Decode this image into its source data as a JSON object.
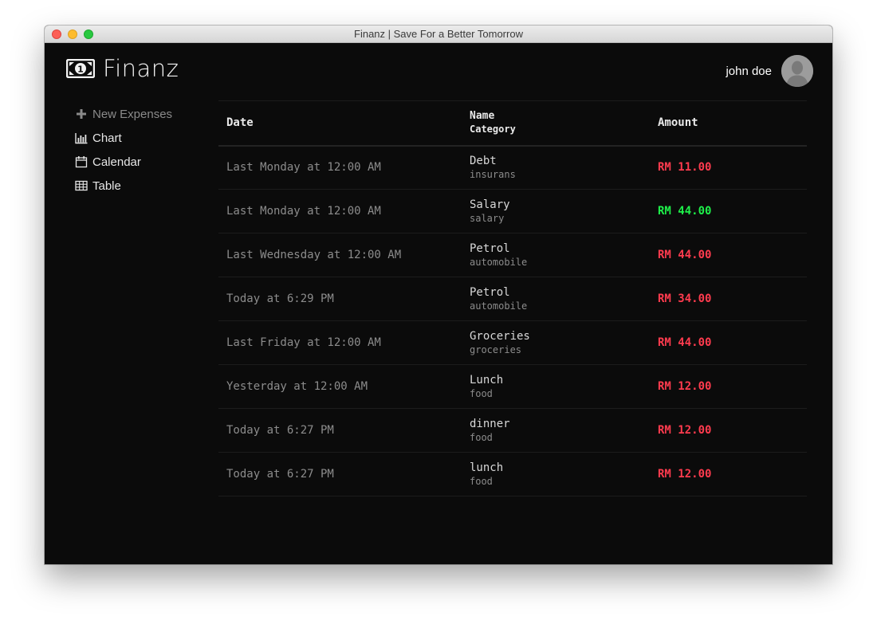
{
  "window": {
    "title": "Finanz | Save For a Better Tomorrow"
  },
  "app": {
    "brand": "Finanz",
    "brand_icon": "money-bill-icon"
  },
  "user": {
    "name": "john doe",
    "avatar_icon": "user-avatar-icon"
  },
  "sidebar": {
    "items": [
      {
        "label": "New Expenses",
        "icon": "plus-icon"
      },
      {
        "label": "Chart",
        "icon": "bar-chart-icon"
      },
      {
        "label": "Calendar",
        "icon": "calendar-icon"
      },
      {
        "label": "Table",
        "icon": "table-icon"
      }
    ]
  },
  "table": {
    "headers": {
      "date": "Date",
      "name": "Name",
      "category": "Category",
      "amount": "Amount"
    },
    "rows": [
      {
        "date": "Last Monday at 12:00 AM",
        "name": "Debt",
        "category": "insurans",
        "amount": "RM 11.00",
        "type": "expense"
      },
      {
        "date": "Last Monday at 12:00 AM",
        "name": "Salary",
        "category": "salary",
        "amount": "RM 44.00",
        "type": "income"
      },
      {
        "date": "Last Wednesday at 12:00 AM",
        "name": "Petrol",
        "category": "automobile",
        "amount": "RM 44.00",
        "type": "expense"
      },
      {
        "date": "Today at 6:29 PM",
        "name": "Petrol",
        "category": "automobile",
        "amount": "RM 34.00",
        "type": "expense"
      },
      {
        "date": "Last Friday at 12:00 AM",
        "name": "Groceries",
        "category": "groceries",
        "amount": "RM 44.00",
        "type": "expense"
      },
      {
        "date": "Yesterday at 12:00 AM",
        "name": "Lunch",
        "category": "food",
        "amount": "RM 12.00",
        "type": "expense"
      },
      {
        "date": "Today at 6:27 PM",
        "name": "dinner",
        "category": "food",
        "amount": "RM 12.00",
        "type": "expense"
      },
      {
        "date": "Today at 6:27 PM",
        "name": "lunch",
        "category": "food",
        "amount": "RM 12.00",
        "type": "expense"
      }
    ]
  },
  "colors": {
    "expense": "#ff3b4e",
    "income": "#1ef04a",
    "background": "#0b0b0b"
  }
}
